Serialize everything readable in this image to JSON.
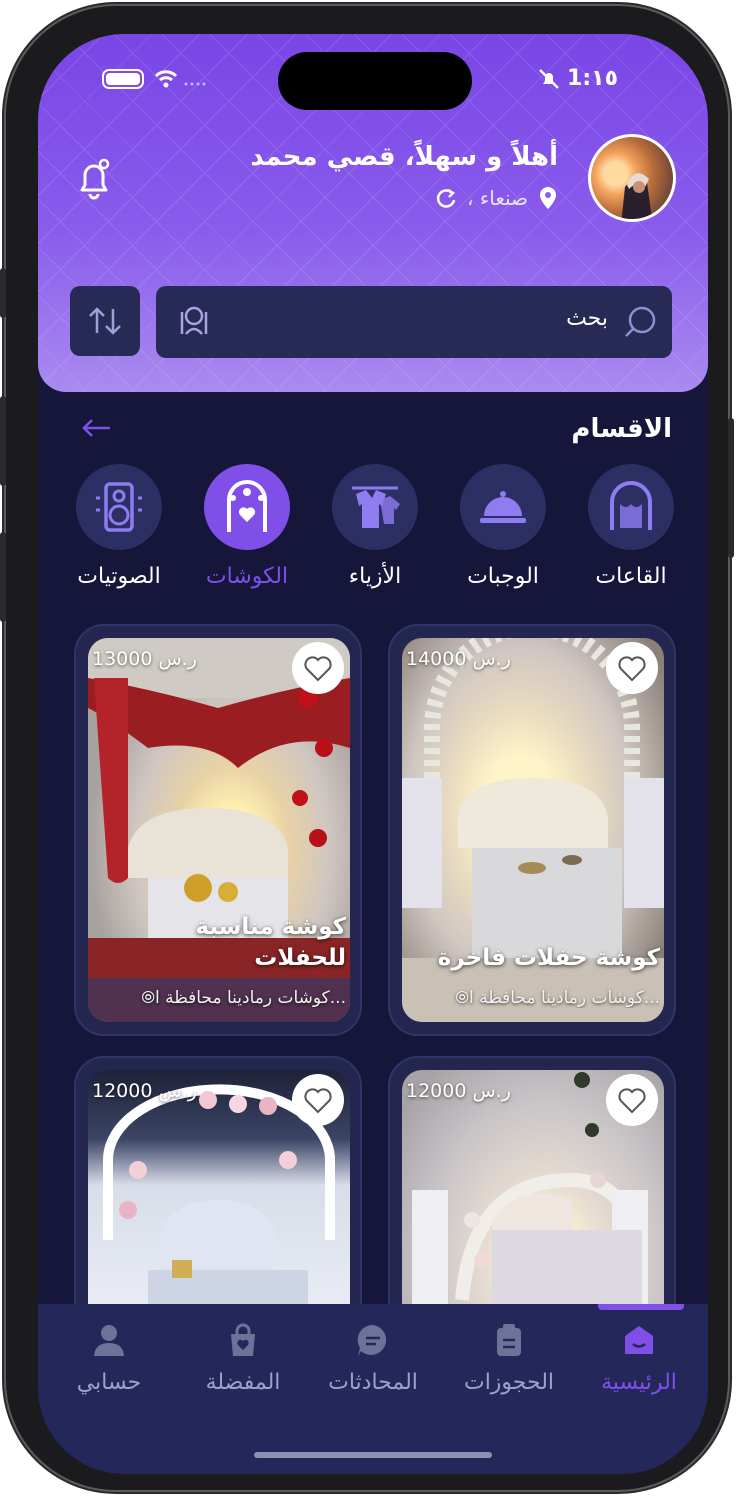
{
  "status": {
    "time": "1:١٥"
  },
  "header": {
    "greeting": "أهلاً و سهلاً، قصي محمد",
    "location": "صنعاء ،",
    "search_placeholder": "بحث"
  },
  "categories": {
    "title": "الاقسام",
    "items": [
      {
        "label": "القاعات",
        "icon": "hall-icon"
      },
      {
        "label": "الوجبات",
        "icon": "meal-icon"
      },
      {
        "label": "الأزياء",
        "icon": "clothes-icon"
      },
      {
        "label": "الكوشات",
        "icon": "kosha-icon",
        "active": true
      },
      {
        "label": "الصوتيات",
        "icon": "speaker-icon"
      }
    ]
  },
  "cards": [
    {
      "price": "14000 ر.س",
      "title": "كوشة حفلات فاخرة",
      "location": "كوشات رمادينا محافظة ا..."
    },
    {
      "price": "13000 ر.س",
      "title": "كوشة مناسبة للحفلات",
      "location": "كوشات رمادينا محافظة ا..."
    },
    {
      "price": "12000 ر.س",
      "title": "",
      "location": ""
    },
    {
      "price": "12000 ر.س",
      "title": "",
      "location": ""
    }
  ],
  "nav": {
    "items": [
      {
        "label": "الرئيسية",
        "icon": "home-icon",
        "active": true
      },
      {
        "label": "الحجوزات",
        "icon": "bookings-icon"
      },
      {
        "label": "المحادثات",
        "icon": "chat-icon"
      },
      {
        "label": "المفضلة",
        "icon": "favorites-icon"
      },
      {
        "label": "حسابي",
        "icon": "profile-icon"
      }
    ]
  },
  "colors": {
    "accent": "#7f4fe8",
    "background": "#15163a",
    "header": "#7a45e6"
  }
}
